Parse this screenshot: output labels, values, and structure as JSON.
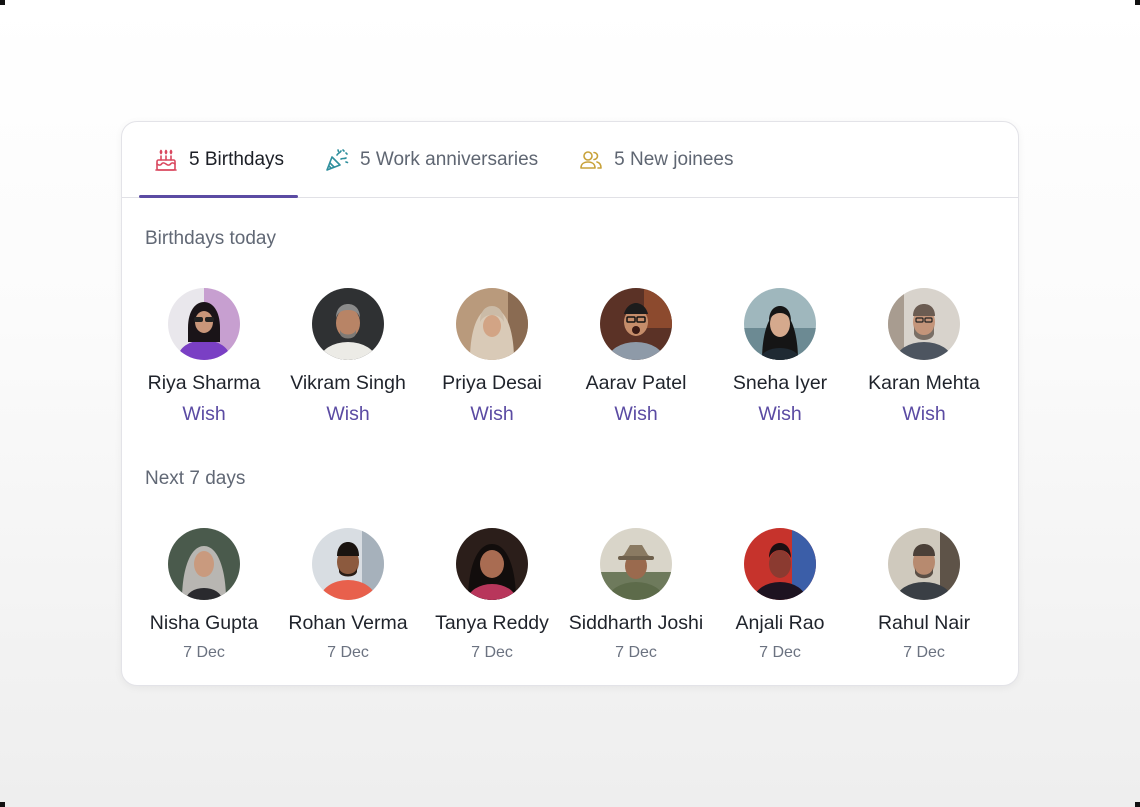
{
  "tabs": [
    {
      "label": "5 Birthdays",
      "icon": "cake-icon",
      "active": true
    },
    {
      "label": "5 Work anniversaries",
      "icon": "party-popper-icon",
      "active": false
    },
    {
      "label": "5 New joinees",
      "icon": "users-icon",
      "active": false
    }
  ],
  "colors": {
    "accent": "#5b4ba3",
    "cake": "#d9485f",
    "party": "#2f8f9d",
    "users": "#c8a23a"
  },
  "today": {
    "title": "Birthdays today",
    "action_label": "Wish",
    "people": [
      {
        "name": "Riya Sharma"
      },
      {
        "name": "Vikram Singh"
      },
      {
        "name": "Priya Desai"
      },
      {
        "name": "Aarav Patel"
      },
      {
        "name": "Sneha Iyer"
      },
      {
        "name": "Karan Mehta"
      }
    ]
  },
  "upcoming": {
    "title": "Next 7 days",
    "people": [
      {
        "name": "Nisha Gupta",
        "date": "7 Dec"
      },
      {
        "name": "Rohan Verma",
        "date": "7 Dec"
      },
      {
        "name": "Tanya Reddy",
        "date": "7 Dec"
      },
      {
        "name": "Siddharth Joshi",
        "date": "7 Dec"
      },
      {
        "name": "Anjali Rao",
        "date": "7 Dec"
      },
      {
        "name": "Rahul Nair",
        "date": "7 Dec"
      }
    ]
  }
}
